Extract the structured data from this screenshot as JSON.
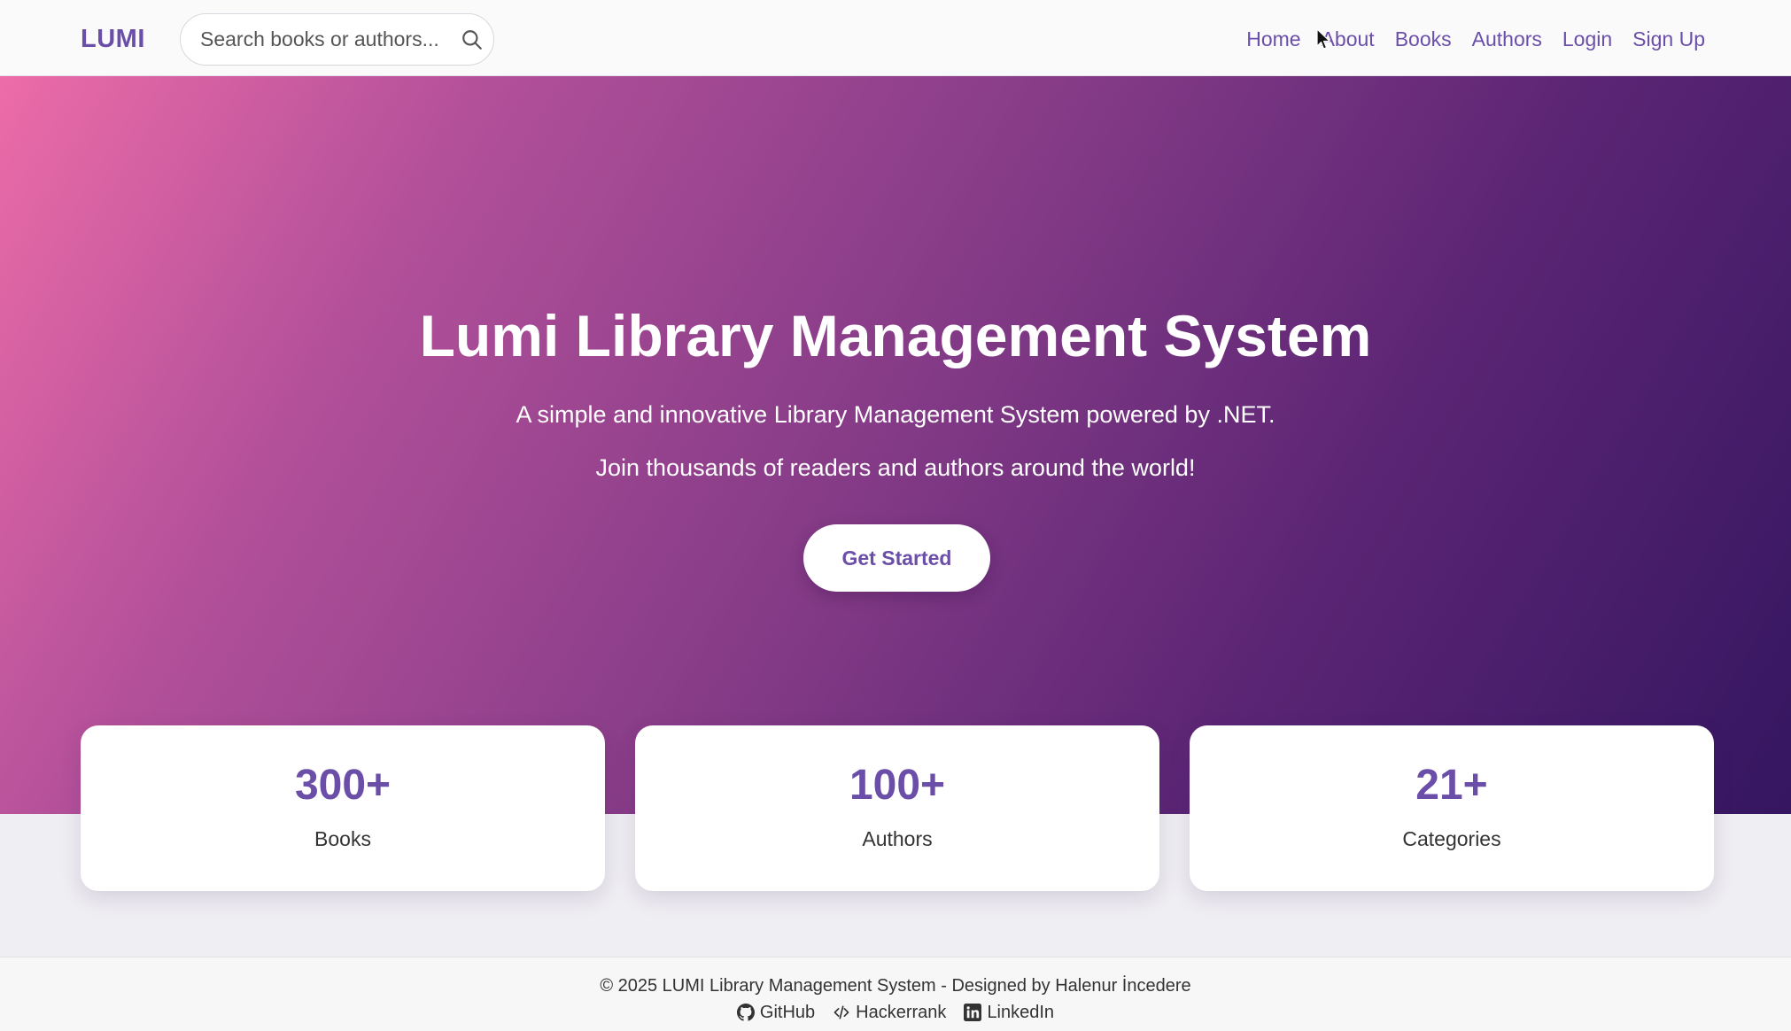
{
  "navbar": {
    "brand": "LUMI",
    "search": {
      "placeholder": "Search books or authors..."
    },
    "links": [
      "Home",
      "About",
      "Books",
      "Authors",
      "Login",
      "Sign Up"
    ]
  },
  "hero": {
    "title": "Lumi Library Management System",
    "subtitle_1": "A simple and innovative Library Management System powered by .NET.",
    "subtitle_2": "Join thousands of readers and authors around the world!",
    "cta": "Get Started"
  },
  "stats": [
    {
      "value": "300+",
      "label": "Books"
    },
    {
      "value": "100+",
      "label": "Authors"
    },
    {
      "value": "21+",
      "label": "Categories"
    }
  ],
  "footer": {
    "copyright": "© 2025 LUMI Library Management System - Designed by Halenur İncedere",
    "links": [
      {
        "label": "GitHub",
        "icon": "github-icon"
      },
      {
        "label": "Hackerrank",
        "icon": "code-icon"
      },
      {
        "label": "LinkedIn",
        "icon": "linkedin-icon"
      }
    ]
  },
  "colors": {
    "accent": "#6a4ea8",
    "hero_start": "#ec6ca8",
    "hero_end": "#351660"
  }
}
